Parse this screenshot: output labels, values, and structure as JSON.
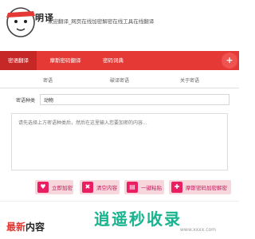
{
  "header": {
    "logo_text": "明译",
    "tagline": "欢迎翻译_网页在线加密解密在线工具在线翻译"
  },
  "nav": {
    "items": [
      "密语翻译",
      "摩斯密码翻译",
      "密码词典"
    ],
    "circle_text": "+"
  },
  "tabs": [
    "密语",
    "破译密语",
    "关于密语"
  ],
  "type": {
    "label": "密语种类",
    "value": "动物"
  },
  "textarea": {
    "placeholder": "请先选择上方密语种类后，然后在这里输入您要加密的内容..."
  },
  "buttons": [
    {
      "label": "立即加密",
      "icon": "heart-icon"
    },
    {
      "label": "清空内容",
      "icon": "trash-icon"
    },
    {
      "label": "一键粘贴",
      "icon": "paste-icon"
    },
    {
      "label": "摩斯密码加密解密",
      "icon": "tools-icon"
    }
  ],
  "latest": {
    "part1": "最新",
    "part2": "内容"
  },
  "watermark": {
    "text": "逍遥秒收录",
    "sub": "www.xxxx.com"
  },
  "colors": {
    "accent": "#e53935",
    "button_bg": "#f8d7dc",
    "button_icon": "#e91e63",
    "watermark": "#19b38f"
  }
}
